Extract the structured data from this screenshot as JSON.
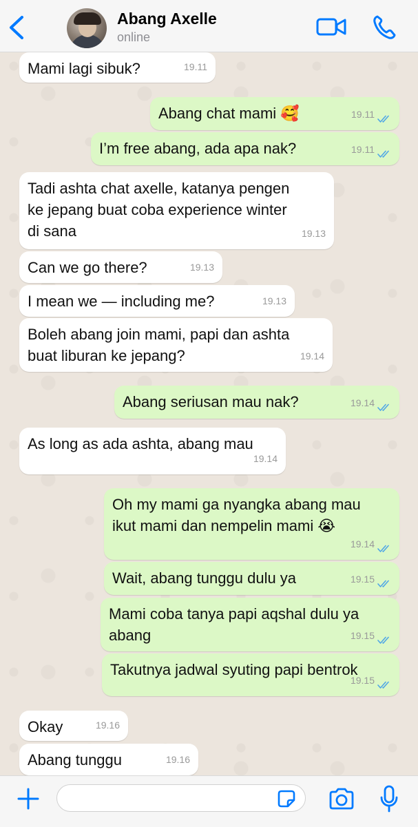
{
  "header": {
    "contact_name": "Abang Axelle",
    "status": "online"
  },
  "messages": [
    {
      "dir": "in",
      "text": "Mami lagi sibuk?",
      "time": "19.11"
    },
    {
      "dir": "out",
      "text": "Abang chat mami 🥰",
      "time": "19.11"
    },
    {
      "dir": "out",
      "text": "I’m free abang, ada apa nak?",
      "time": "19.11"
    },
    {
      "dir": "in",
      "text": "Tadi ashta chat axelle, katanya pengen\nke jepang buat coba experience winter\ndi sana",
      "time": "19.13"
    },
    {
      "dir": "in",
      "text": "Can we go there?",
      "time": "19.13"
    },
    {
      "dir": "in",
      "text": "I mean we — including me?",
      "time": "19.13"
    },
    {
      "dir": "in",
      "text": "Boleh abang join mami, papi dan ashta\nbuat liburan ke jepang?",
      "time": "19.14"
    },
    {
      "dir": "out",
      "text": "Abang seriusan mau nak?",
      "time": "19.14"
    },
    {
      "dir": "in",
      "text": "As long as ada ashta, abang mau",
      "time": "19.14"
    },
    {
      "dir": "out",
      "text": "Oh my mami ga nyangka abang mau\nikut mami dan nempelin mami 😭",
      "time": "19.14"
    },
    {
      "dir": "out",
      "text": "Wait, abang tunggu dulu ya",
      "time": "19.15"
    },
    {
      "dir": "out",
      "text": "Mami coba tanya papi aqshal dulu ya\nabang",
      "time": "19.15"
    },
    {
      "dir": "out",
      "text": "Takutnya jadwal syuting papi bentrok",
      "time": "19.15"
    },
    {
      "dir": "in",
      "text": "Okay",
      "time": "19.16"
    },
    {
      "dir": "in",
      "text": "Abang tunggu",
      "time": "19.16"
    }
  ],
  "footer": {
    "input_placeholder": ""
  },
  "colors": {
    "accent": "#007aff",
    "incoming_bubble": "#ffffff",
    "outgoing_bubble": "#dcf8c6",
    "read_ticks": "#4fa6e6",
    "chat_background": "#ece5dd"
  },
  "icons": [
    "back-chevron-icon",
    "video-call-icon",
    "phone-icon",
    "plus-icon",
    "sticker-icon",
    "camera-icon",
    "microphone-icon",
    "read-receipt-icon"
  ]
}
